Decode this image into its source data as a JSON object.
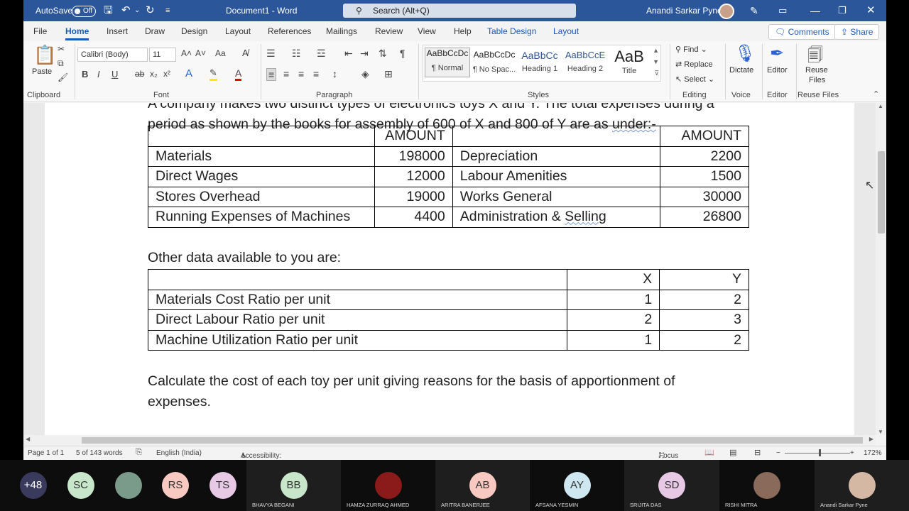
{
  "titlebar": {
    "autosave_label": "AutoSave",
    "autosave_state": "Off",
    "doc_title": "Document1  -  Word",
    "search_placeholder": "Search (Alt+Q)",
    "user_name": "Anandi Sarkar Pyne"
  },
  "tabs": [
    "File",
    "Home",
    "Insert",
    "Draw",
    "Design",
    "Layout",
    "References",
    "Mailings",
    "Review",
    "View",
    "Help",
    "Table Design",
    "Layout"
  ],
  "tabs_right": {
    "comments": "Comments",
    "share": "Share"
  },
  "ribbon": {
    "clipboard": {
      "paste": "Paste",
      "label": "Clipboard"
    },
    "font": {
      "name": "Calibri (Body)",
      "size": "11",
      "label": "Font"
    },
    "paragraph": {
      "label": "Paragraph"
    },
    "styles": {
      "label": "Styles",
      "items": [
        {
          "sample": "AaBbCcDc",
          "name": "¶ Normal"
        },
        {
          "sample": "AaBbCcDc",
          "name": "¶ No Spac..."
        },
        {
          "sample": "AaBbCc",
          "name": "Heading 1"
        },
        {
          "sample": "AaBbCcE",
          "name": "Heading 2"
        },
        {
          "sample": "AaB",
          "name": "Title"
        }
      ]
    },
    "editing": {
      "find": "Find",
      "replace": "Replace",
      "select": "Select",
      "label": "Editing"
    },
    "voice": {
      "dictate": "Dictate",
      "label": "Voice"
    },
    "editor": {
      "editor": "Editor",
      "label": "Editor"
    },
    "reuse": {
      "line1": "Reuse",
      "line2": "Files",
      "label": "Reuse Files"
    }
  },
  "document": {
    "intro_line1": "A company makes two distinct types of electronics toys X and Y. The total expenses during a",
    "intro_line2_prefix": "period as shown by the books for assembly of 600 of X and 800 of Y are as ",
    "intro_line2_squig": "under:-",
    "expenses_table": {
      "headers": [
        "",
        "AMOUNT",
        "",
        "AMOUNT"
      ],
      "rows": [
        [
          "Materials",
          "198000",
          "Depreciation",
          "2200"
        ],
        [
          "Direct Wages",
          "12000",
          "Labour Amenities",
          "1500"
        ],
        [
          "Stores Overhead",
          "19000",
          "Works General",
          "30000"
        ],
        [
          "Running Expenses of Machines",
          "4400",
          "Administration & ",
          "26800"
        ]
      ],
      "last_row_squig": "Selling"
    },
    "other_data": "Other data available to you are:",
    "ratio_table": {
      "headers": [
        "",
        "X",
        "Y"
      ],
      "rows": [
        [
          "Materials Cost Ratio per unit",
          "1",
          "2"
        ],
        [
          "Direct Labour Ratio per unit",
          "2",
          "3"
        ],
        [
          "Machine Utilization Ratio per unit",
          "1",
          "2"
        ]
      ]
    },
    "question_line1": "Calculate the cost of each toy per unit giving reasons for the basis of apportionment of",
    "question_line2": "expenses."
  },
  "statusbar": {
    "page": "Page 1 of 1",
    "words": "5 of 143 words",
    "language": "English (India)",
    "accessibility": "Accessibility: Investigate",
    "focus": "Focus",
    "zoom": "172%"
  },
  "participants": [
    {
      "initials": "+48",
      "name": "",
      "bg": "#3a3a5c",
      "fg": "#ffffff"
    },
    {
      "initials": "SC",
      "name": "",
      "bg": "#c8e6c9",
      "fg": "#333333"
    },
    {
      "initials": "",
      "name": "",
      "bg": "#7a9a8a",
      "fg": "#333333"
    },
    {
      "initials": "RS",
      "name": "",
      "bg": "#f8c9c0",
      "fg": "#333333"
    },
    {
      "initials": "TS",
      "name": "",
      "bg": "#e7c9e6",
      "fg": "#333333"
    },
    {
      "initials": "BB",
      "name": "BHAVYA BEGANI",
      "bg": "#c8e6c9",
      "fg": "#333333"
    },
    {
      "initials": "",
      "name": "HAMZA ZURRAQ AHMED",
      "bg": "#8b1a1a",
      "fg": "#333333"
    },
    {
      "initials": "AB",
      "name": "ARITRA BANERJEE",
      "bg": "#f8c9c0",
      "fg": "#333333"
    },
    {
      "initials": "AY",
      "name": "AFSANA YESMIN",
      "bg": "#cfe7f0",
      "fg": "#333333"
    },
    {
      "initials": "SD",
      "name": "SRIJITA DAS",
      "bg": "#e7c9e6",
      "fg": "#333333"
    },
    {
      "initials": "",
      "name": "RISHI MITRA",
      "bg": "#8a6a5a",
      "fg": "#333333"
    },
    {
      "initials": "",
      "name": "Anandi Sarkar Pyne",
      "bg": "#d4b8a4",
      "fg": "#333333"
    }
  ]
}
